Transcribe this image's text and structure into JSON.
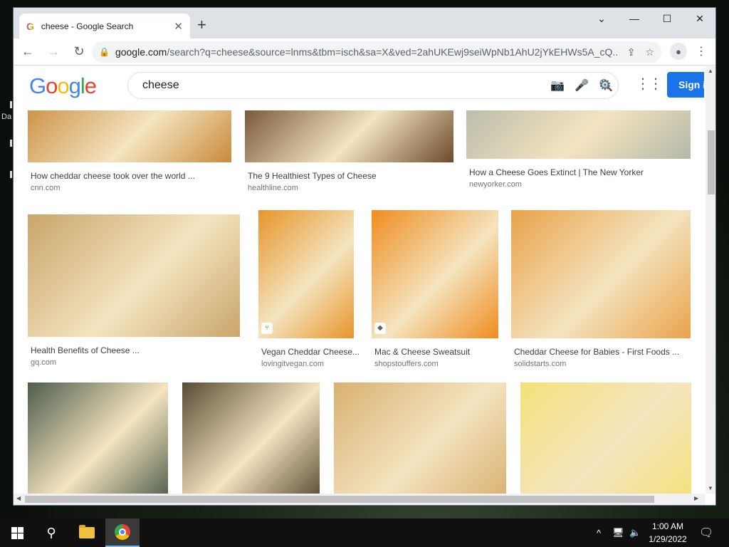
{
  "browser": {
    "tab_title": "cheese - Google Search",
    "tab_favicon": "G",
    "new_tab": "+",
    "url_host": "google.com",
    "url_path": "/search?q=cheese&source=lnms&tbm=isch&sa=X&ved=2ahUKEwj9seiWpNb1AhU2jYkEHWs5A_cQ...",
    "controls": {
      "chevron": "⌄",
      "minimize": "—",
      "maximize": "☐",
      "close": "✕"
    }
  },
  "search": {
    "query": "cheese",
    "sign_in": "Sign in"
  },
  "results": [
    {
      "title": "How cheddar cheese took over the world ...",
      "source": "cnn.com",
      "color": "#c98a3c"
    },
    {
      "title": "The 9 Healthiest Types of Cheese",
      "source": "healthline.com",
      "color": "#6b4a2a"
    },
    {
      "title": "How a Cheese Goes Extinct | The New Yorker",
      "source": "newyorker.com",
      "color": "#b5b9a8"
    },
    {
      "title": "Health Benefits of Cheese ...",
      "source": "gq.com",
      "color": "#c9a56a"
    },
    {
      "title": "Vegan Cheddar Cheese...",
      "source": "lovingitvegan.com",
      "color": "#e8942a",
      "badge": "recipe-icon"
    },
    {
      "title": "Mac & Cheese Sweatsuit",
      "source": "shopstouffers.com",
      "color": "#f08c1e",
      "badge": "tag-icon"
    },
    {
      "title": "Cheddar Cheese for Babies - First Foods ...",
      "source": "solidstarts.com",
      "color": "#e9a24a"
    },
    {
      "title": "",
      "source": "",
      "color": "#4d5c4a"
    },
    {
      "title": "",
      "source": "",
      "color": "#5a4a34"
    },
    {
      "title": "",
      "source": "",
      "color": "#d9b070"
    },
    {
      "title": "",
      "source": "",
      "color": "#f3e27a"
    }
  ],
  "taskbar": {
    "time": "1:00 AM",
    "date": "1/29/2022"
  },
  "desktop": {
    "label": "Da"
  }
}
